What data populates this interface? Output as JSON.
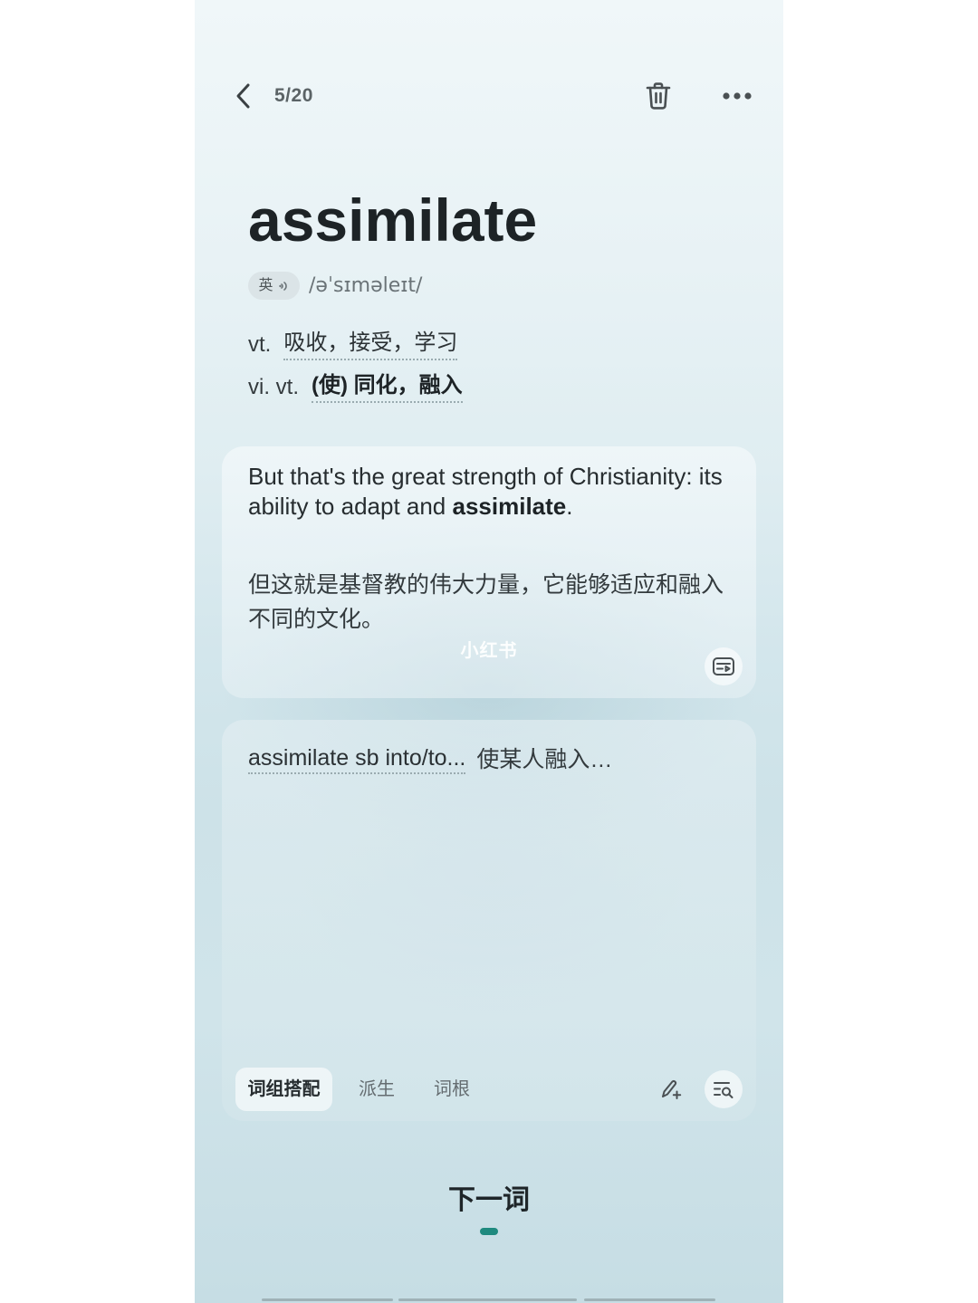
{
  "header": {
    "progress": "5/20"
  },
  "word": {
    "headword": "assimilate",
    "accent": "英",
    "phonetic": "/əˈsɪməleɪt/"
  },
  "definitions": [
    {
      "pos": "vt.",
      "meaning": "吸收，接受，学习"
    },
    {
      "pos": "vi. vt.",
      "meaning": "(使) 同化，融入"
    }
  ],
  "example": {
    "en_before": "But that's the great strength of Christianity: its ability to adapt and ",
    "en_keyword": "assimilate",
    "en_after": ".",
    "zh": "但这就是基督教的伟大力量，它能够适应和融入不同的文化。"
  },
  "watermark": "小红书",
  "phrases": [
    {
      "phrase": "assimilate sb into/to...",
      "meaning": "使某人融入…"
    }
  ],
  "tabs": [
    {
      "label": "词组搭配",
      "active": true
    },
    {
      "label": "派生",
      "active": false
    },
    {
      "label": "词根",
      "active": false
    }
  ],
  "next_button": "下一词",
  "icons": {
    "back": "chevron-left-icon",
    "delete": "trash-icon",
    "more": "more-dots-icon",
    "audio": "speaker-icon",
    "example_action": "subtitle-card-icon",
    "note": "pen-plus-icon",
    "lookup": "list-search-icon"
  },
  "colors": {
    "background": "#e6f1f4",
    "text": "#1d2326",
    "muted": "#6a7377",
    "accent": "#1f8a7f",
    "card": "#eef5f7"
  }
}
